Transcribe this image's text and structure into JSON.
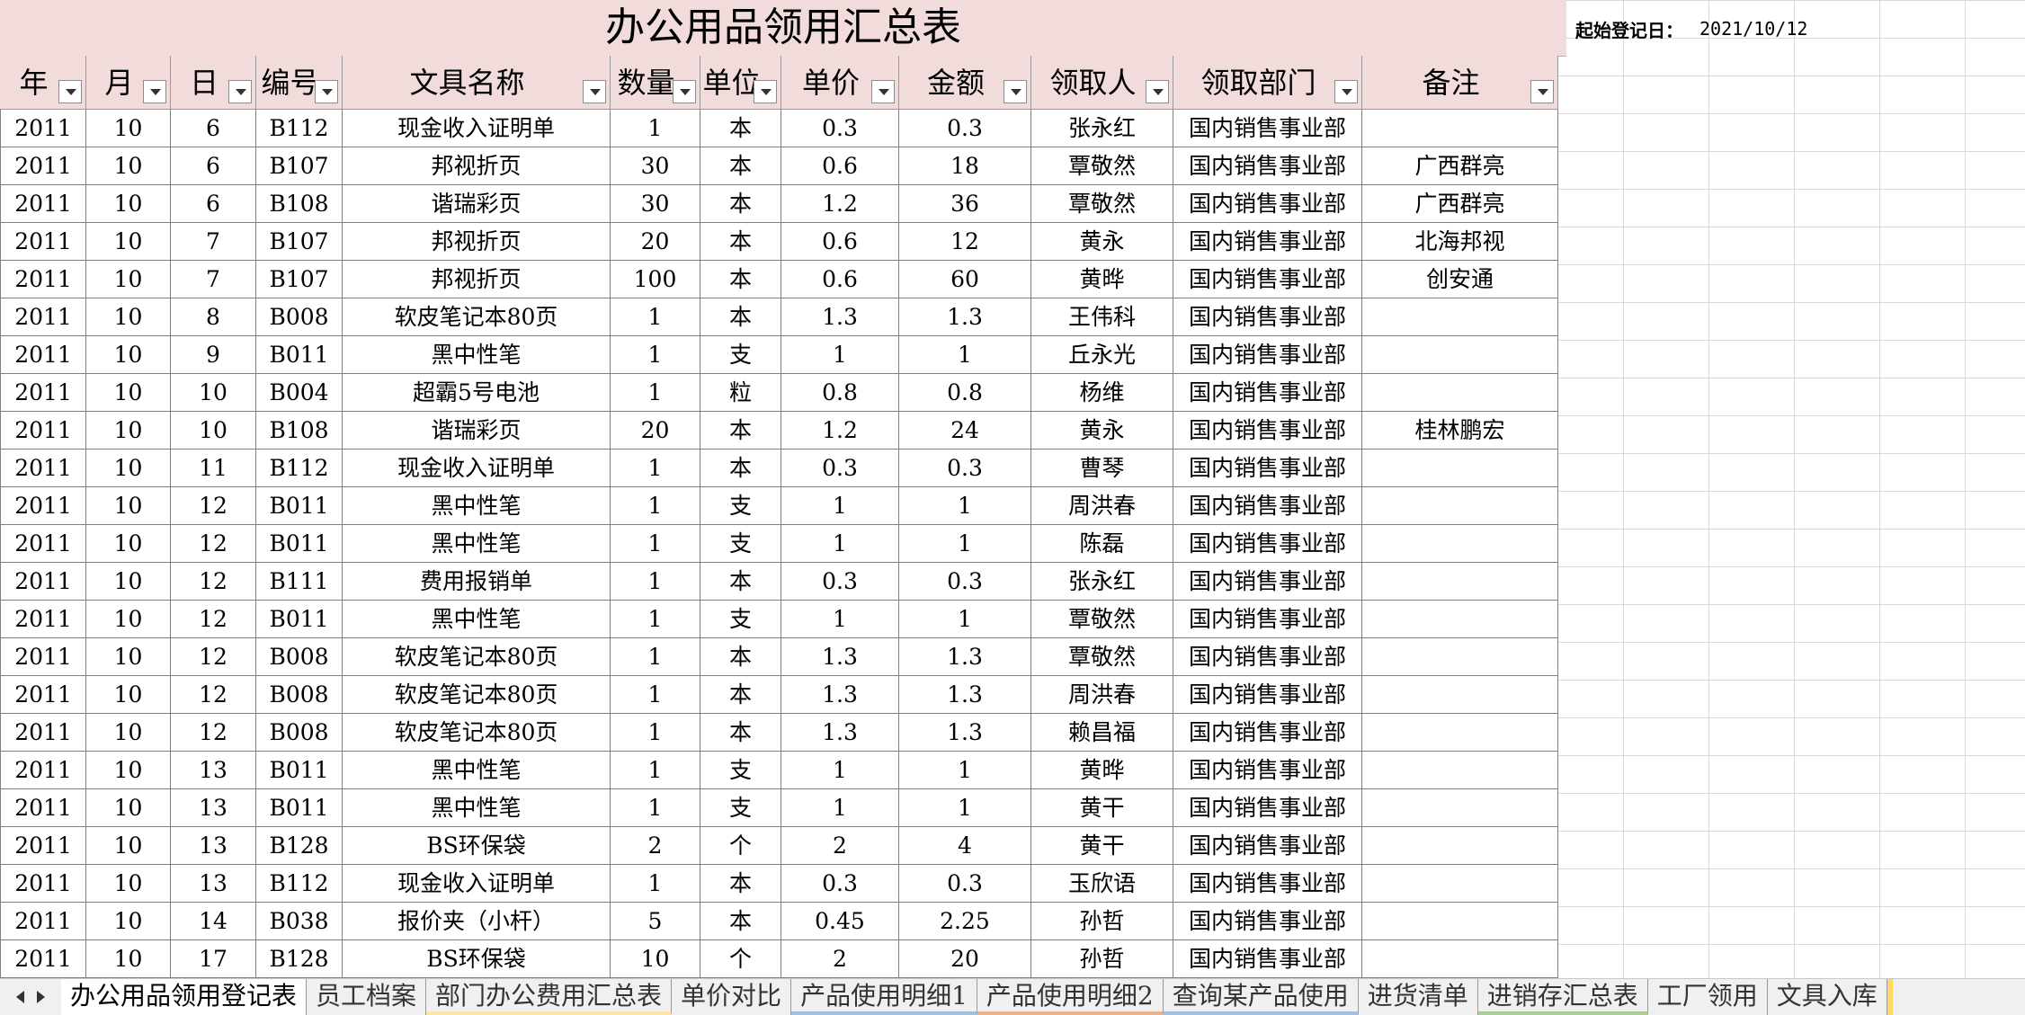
{
  "sheet": {
    "title": "办公用品领用汇总表",
    "start_label": "起始登记日：",
    "start_value": "2021/10/12"
  },
  "columns": [
    "年",
    "月",
    "日",
    "编号",
    "文具名称",
    "数量",
    "单位",
    "单价",
    "金额",
    "领取人",
    "领取部门",
    "备注"
  ],
  "rows": [
    [
      "2011",
      "10",
      "6",
      "B112",
      "现金收入证明单",
      "1",
      "本",
      "0.3",
      "0.3",
      "张永红",
      "国内销售事业部",
      ""
    ],
    [
      "2011",
      "10",
      "6",
      "B107",
      "邦视折页",
      "30",
      "本",
      "0.6",
      "18",
      "覃敬然",
      "国内销售事业部",
      "广西群亮"
    ],
    [
      "2011",
      "10",
      "6",
      "B108",
      "谐瑞彩页",
      "30",
      "本",
      "1.2",
      "36",
      "覃敬然",
      "国内销售事业部",
      "广西群亮"
    ],
    [
      "2011",
      "10",
      "7",
      "B107",
      "邦视折页",
      "20",
      "本",
      "0.6",
      "12",
      "黄永",
      "国内销售事业部",
      "北海邦视"
    ],
    [
      "2011",
      "10",
      "7",
      "B107",
      "邦视折页",
      "100",
      "本",
      "0.6",
      "60",
      "黄晔",
      "国内销售事业部",
      "创安通"
    ],
    [
      "2011",
      "10",
      "8",
      "B008",
      "软皮笔记本80页",
      "1",
      "本",
      "1.3",
      "1.3",
      "王伟科",
      "国内销售事业部",
      ""
    ],
    [
      "2011",
      "10",
      "9",
      "B011",
      "黑中性笔",
      "1",
      "支",
      "1",
      "1",
      "丘永光",
      "国内销售事业部",
      ""
    ],
    [
      "2011",
      "10",
      "10",
      "B004",
      "超霸5号电池",
      "1",
      "粒",
      "0.8",
      "0.8",
      "杨维",
      "国内销售事业部",
      ""
    ],
    [
      "2011",
      "10",
      "10",
      "B108",
      "谐瑞彩页",
      "20",
      "本",
      "1.2",
      "24",
      "黄永",
      "国内销售事业部",
      "桂林鹏宏"
    ],
    [
      "2011",
      "10",
      "11",
      "B112",
      "现金收入证明单",
      "1",
      "本",
      "0.3",
      "0.3",
      "曹琴",
      "国内销售事业部",
      ""
    ],
    [
      "2011",
      "10",
      "12",
      "B011",
      "黑中性笔",
      "1",
      "支",
      "1",
      "1",
      "周洪春",
      "国内销售事业部",
      ""
    ],
    [
      "2011",
      "10",
      "12",
      "B011",
      "黑中性笔",
      "1",
      "支",
      "1",
      "1",
      "陈磊",
      "国内销售事业部",
      ""
    ],
    [
      "2011",
      "10",
      "12",
      "B111",
      "费用报销单",
      "1",
      "本",
      "0.3",
      "0.3",
      "张永红",
      "国内销售事业部",
      ""
    ],
    [
      "2011",
      "10",
      "12",
      "B011",
      "黑中性笔",
      "1",
      "支",
      "1",
      "1",
      "覃敬然",
      "国内销售事业部",
      ""
    ],
    [
      "2011",
      "10",
      "12",
      "B008",
      "软皮笔记本80页",
      "1",
      "本",
      "1.3",
      "1.3",
      "覃敬然",
      "国内销售事业部",
      ""
    ],
    [
      "2011",
      "10",
      "12",
      "B008",
      "软皮笔记本80页",
      "1",
      "本",
      "1.3",
      "1.3",
      "周洪春",
      "国内销售事业部",
      ""
    ],
    [
      "2011",
      "10",
      "12",
      "B008",
      "软皮笔记本80页",
      "1",
      "本",
      "1.3",
      "1.3",
      "赖昌福",
      "国内销售事业部",
      ""
    ],
    [
      "2011",
      "10",
      "13",
      "B011",
      "黑中性笔",
      "1",
      "支",
      "1",
      "1",
      "黄晔",
      "国内销售事业部",
      ""
    ],
    [
      "2011",
      "10",
      "13",
      "B011",
      "黑中性笔",
      "1",
      "支",
      "1",
      "1",
      "黄干",
      "国内销售事业部",
      ""
    ],
    [
      "2011",
      "10",
      "13",
      "B128",
      "BS环保袋",
      "2",
      "个",
      "2",
      "4",
      "黄干",
      "国内销售事业部",
      ""
    ],
    [
      "2011",
      "10",
      "13",
      "B112",
      "现金收入证明单",
      "1",
      "本",
      "0.3",
      "0.3",
      "玉欣语",
      "国内销售事业部",
      ""
    ],
    [
      "2011",
      "10",
      "14",
      "B038",
      "报价夹（小杆）",
      "5",
      "本",
      "0.45",
      "2.25",
      "孙哲",
      "国内销售事业部",
      ""
    ],
    [
      "2011",
      "10",
      "17",
      "B128",
      "BS环保袋",
      "10",
      "个",
      "2",
      "20",
      "孙哲",
      "国内销售事业部",
      ""
    ]
  ],
  "tabs": [
    {
      "label": "办公用品领用登记表",
      "active": true,
      "color": ""
    },
    {
      "label": "员工档案",
      "active": false,
      "color": ""
    },
    {
      "label": "部门办公费用汇总表",
      "active": false,
      "color": "yellow"
    },
    {
      "label": "单价对比",
      "active": false,
      "color": ""
    },
    {
      "label": "产品使用明细1",
      "active": false,
      "color": "teal"
    },
    {
      "label": "产品使用明细2",
      "active": false,
      "color": "red"
    },
    {
      "label": "查询某产品使用",
      "active": false,
      "color": "teal"
    },
    {
      "label": "进货清单",
      "active": false,
      "color": ""
    },
    {
      "label": "进销存汇总表",
      "active": false,
      "color": "green"
    },
    {
      "label": "工厂领用",
      "active": false,
      "color": ""
    },
    {
      "label": "文具入库",
      "active": false,
      "color": ""
    }
  ],
  "icons": {
    "filter": "dropdown-filter-icon",
    "nav_prev": "triangle-left-icon",
    "nav_next": "triangle-right-icon"
  }
}
